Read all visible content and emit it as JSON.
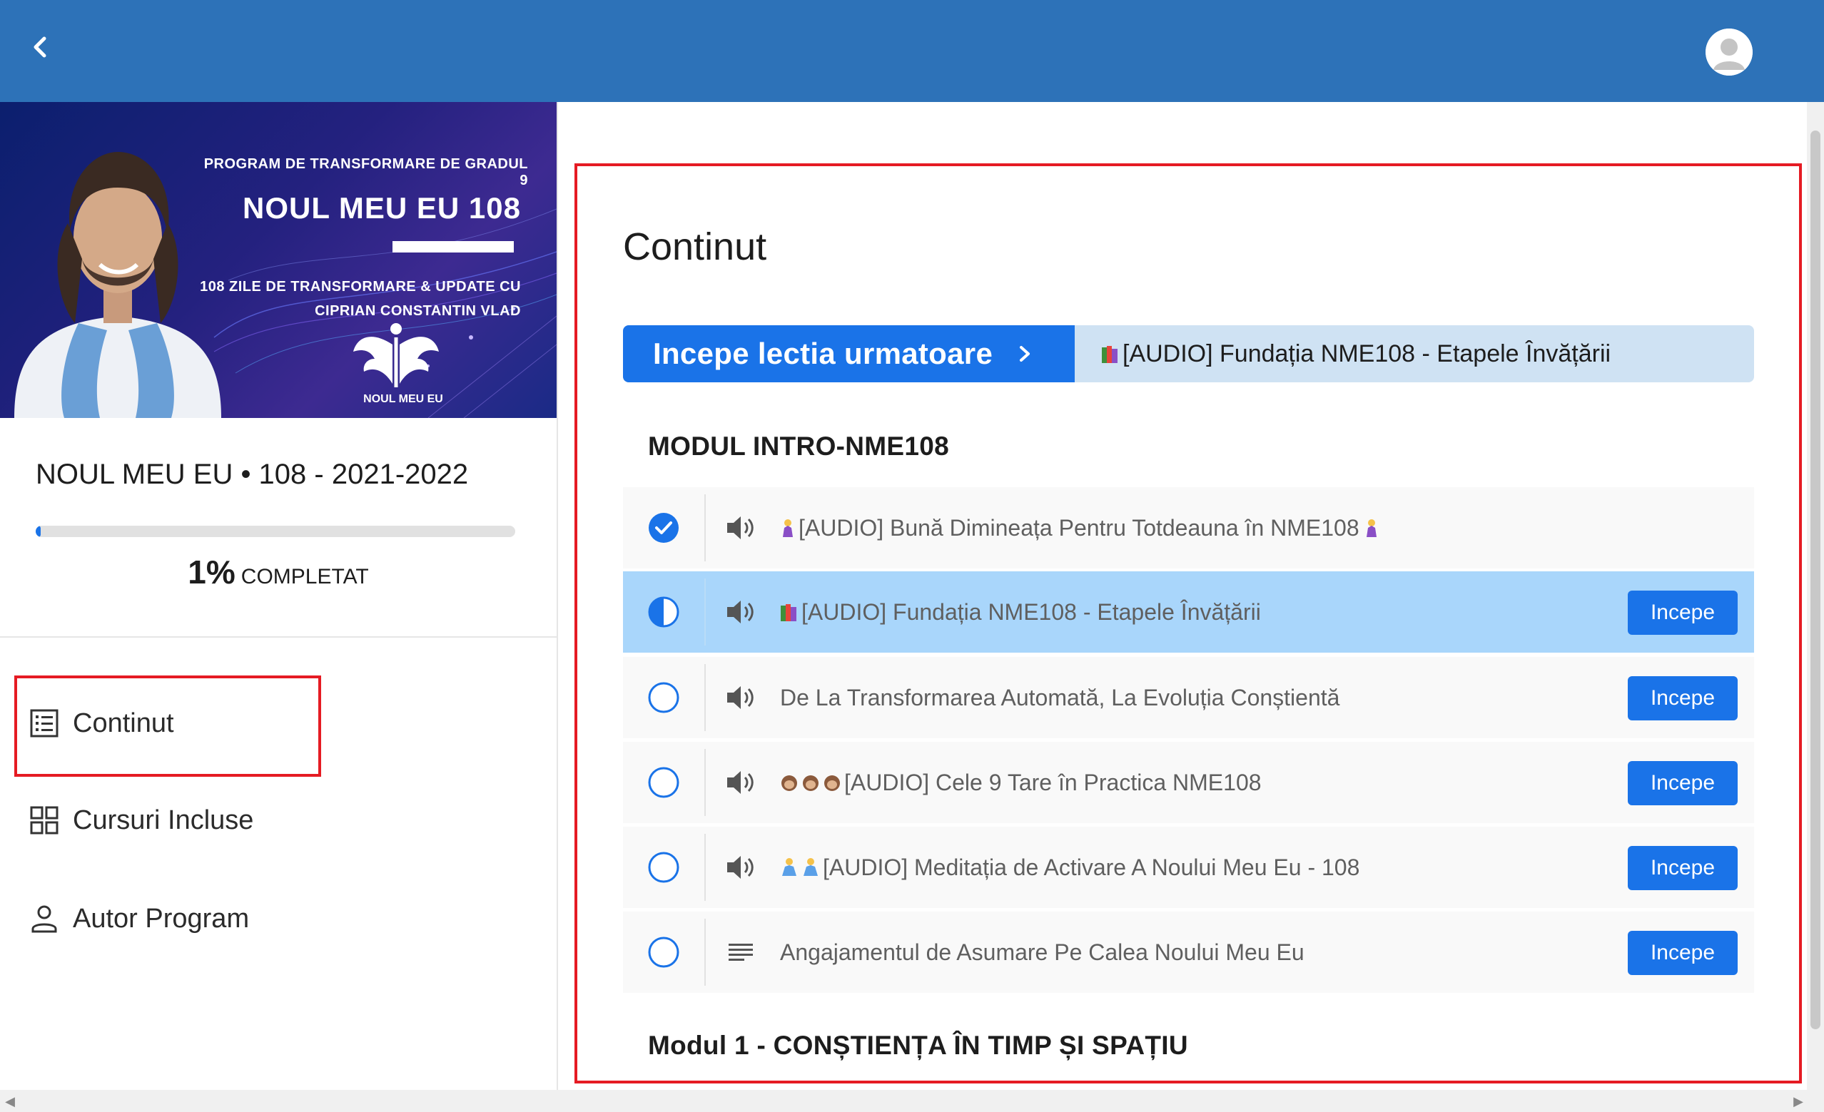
{
  "header": {
    "back_icon": "chevron-left-icon",
    "avatar_icon": "user-avatar-icon"
  },
  "banner": {
    "subtitle_top": "PROGRAM DE TRANSFORMARE DE GRADUL 9",
    "title": "NOUL MEU EU 108",
    "subtitle_line1": "108 ZILE DE TRANSFORMARE & UPDATE CU",
    "subtitle_line2": "CIPRIAN CONSTANTIN VLAD",
    "logo_text": "NOUL MEU EU"
  },
  "course": {
    "title": "NOUL MEU EU • 108 - 2021-2022",
    "progress_fraction": 0.01,
    "progress_percent": "1%",
    "progress_word": "COMPLETAT"
  },
  "sidebar_nav": [
    {
      "label": "Continut",
      "icon": "list-icon"
    },
    {
      "label": "Cursuri Incluse",
      "icon": "grid-icon"
    },
    {
      "label": "Autor Program",
      "icon": "person-icon"
    }
  ],
  "main": {
    "section_title": "Continut",
    "next_button_label": "Incepe lectia urmatoare",
    "next_lesson_title": "[AUDIO] Fundația NME108 - Etapele Învățării",
    "modules": [
      {
        "title": "MODUL INTRO-NME108"
      },
      {
        "title": "Modul 1 - CONȘTIENȚA ÎN TIMP ȘI SPAȚIU"
      }
    ],
    "lessons": [
      {
        "status": "completed",
        "type": "audio",
        "title": "[AUDIO] Bună Dimineața Pentru Totdeauna în NME108",
        "button": ""
      },
      {
        "status": "in-progress",
        "type": "audio",
        "title": "[AUDIO] Fundația NME108 - Etapele Învățării",
        "button": "Incepe"
      },
      {
        "status": "not-started",
        "type": "audio",
        "title": "De La Transformarea Automată, La Evoluția Conștientă",
        "button": "Incepe"
      },
      {
        "status": "not-started",
        "type": "audio",
        "title": "[AUDIO] Cele 9 Tare în Practica NME108",
        "button": "Incepe"
      },
      {
        "status": "not-started",
        "type": "audio",
        "title": "[AUDIO] Meditația de Activare A Noului Meu Eu - 108",
        "button": "Incepe"
      },
      {
        "status": "not-started",
        "type": "text",
        "title": "Angajamentul de Asumare Pe Calea Noului Meu Eu",
        "button": "Incepe"
      }
    ]
  },
  "colors": {
    "header": "#2d72b8",
    "accent": "#1a73e8",
    "highlight": "#e51b23",
    "active_row": "#a9d6fb"
  }
}
